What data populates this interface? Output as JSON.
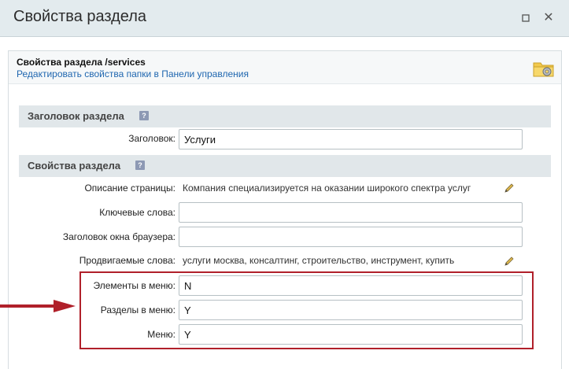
{
  "window": {
    "title": "Свойства раздела"
  },
  "header": {
    "path": "Свойства раздела /services",
    "edit_link": "Редактировать свойства папки в Панели управления"
  },
  "sections": {
    "heading": {
      "title": "Заголовок раздела",
      "help": "?"
    },
    "props": {
      "title": "Свойства раздела",
      "help": "?"
    }
  },
  "fields": {
    "title": {
      "label": "Заголовок:",
      "value": "Услуги"
    },
    "description": {
      "label": "Описание страницы:",
      "value": "Компания специализируется на оказании широкого спектра услуг"
    },
    "keywords": {
      "label": "Ключевые слова:",
      "value": ""
    },
    "browser_title": {
      "label": "Заголовок окна браузера:",
      "value": ""
    },
    "promoted": {
      "label": "Продвигаемые слова:",
      "value": "услуги москва, консалтинг, строительство, инструмент, купить"
    },
    "menu_elements": {
      "label": "Элементы в меню:",
      "value": "N"
    },
    "menu_sections": {
      "label": "Разделы в меню:",
      "value": "Y"
    },
    "menu": {
      "label": "Меню:",
      "value": "Y"
    }
  },
  "colors": {
    "highlight": "#b0202a",
    "link": "#2067b0",
    "section_bg": "#e1e7ea",
    "titlebar_bg": "#e3ebee"
  },
  "icons": {
    "maximize": "maximize-icon",
    "close": "close-icon",
    "folder": "folder-settings-icon",
    "help": "help-icon",
    "edit": "pencil-icon",
    "arrow": "arrow-right-icon"
  }
}
